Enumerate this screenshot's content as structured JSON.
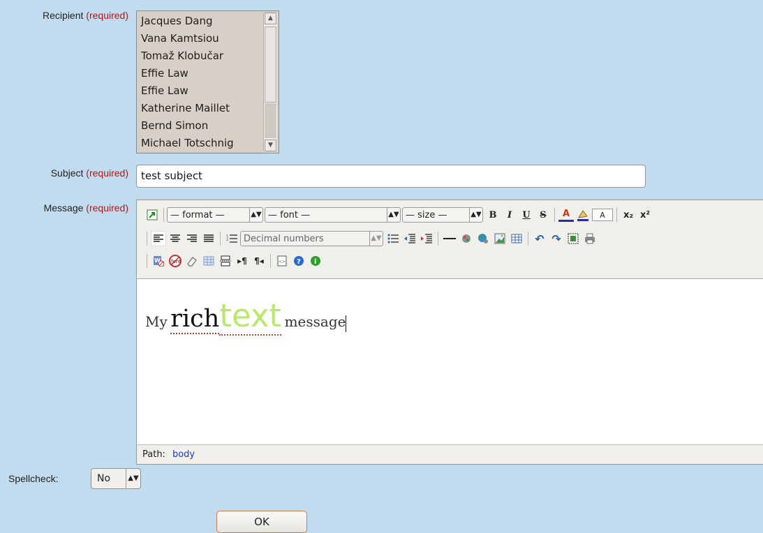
{
  "form": {
    "recipient_label": "Recipient",
    "subject_label": "Subject",
    "message_label": "Message",
    "required_text": "(required)",
    "spellcheck_label": "Spellcheck:",
    "spellcheck_value": "No",
    "ok_label": "OK"
  },
  "recipients": [
    "Jacques Dang",
    "Vana Kamtsiou",
    "Tomaž Klobučar",
    "Effie Law",
    "Effie Law",
    "Katherine Maillet",
    "Bernd Simon",
    "Michael Totschnig"
  ],
  "subject_value": "test subject",
  "toolbar": {
    "format": "— format —",
    "font": "— font —",
    "size": "— size —",
    "list_style": "Decimal numbers",
    "bold": "B",
    "italic": "I",
    "underline": "U",
    "strike": "S",
    "subscript": "x₂",
    "superscript": "x²",
    "forecolor": "A",
    "hilite_box": "A"
  },
  "message": {
    "w1": "My",
    "w2": "rich",
    "w3": "text",
    "w4": "message"
  },
  "pathbar": {
    "label": "Path:",
    "link": "body"
  },
  "colors": {
    "background": "#c0dcee",
    "required": "#b0181c",
    "text_word": "#b9e86b",
    "path_link": "#1a3bcc"
  }
}
